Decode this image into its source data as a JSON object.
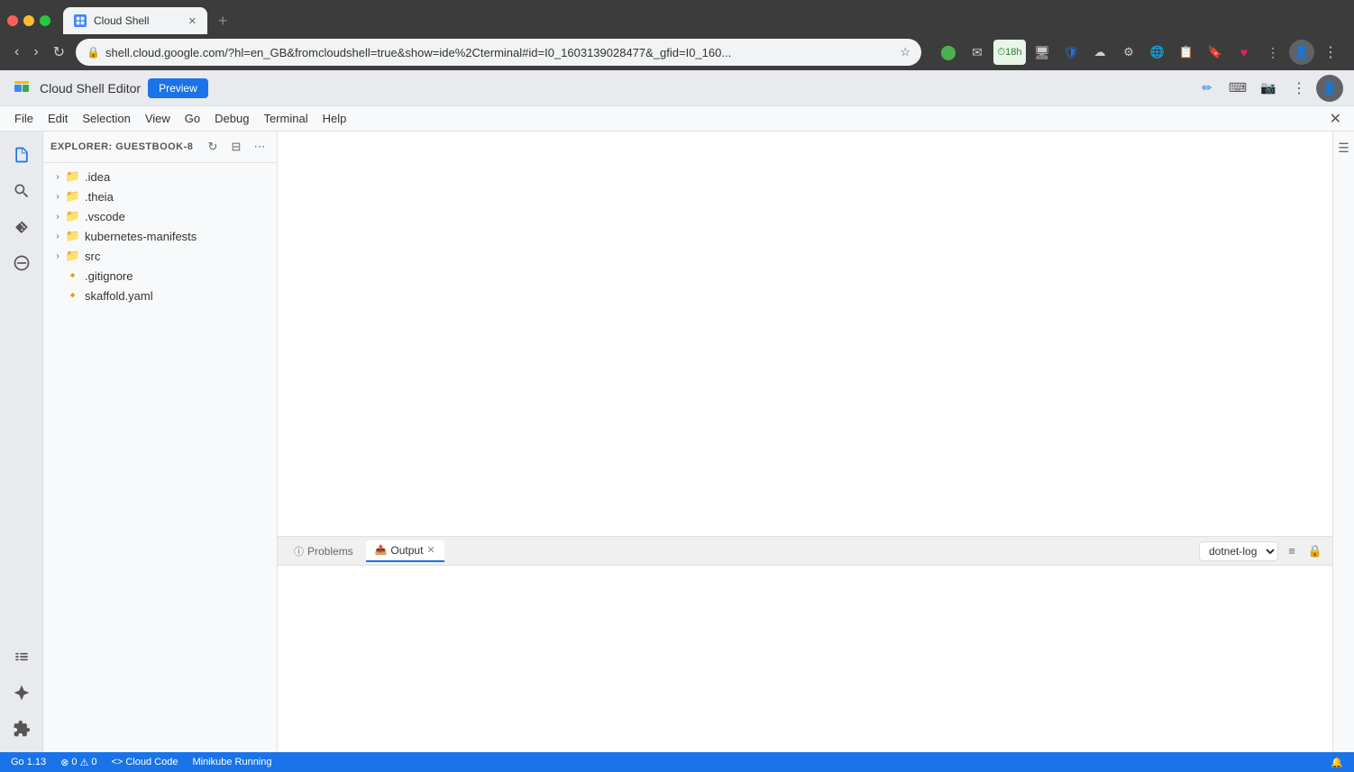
{
  "browser": {
    "tab_title": "Cloud Shell",
    "address": "shell.cloud.google.com/?hl=en_GB&fromcloudshell=true&show=ide%2Cterminal#id=I0_1603139028477&_gfid=I0_160...",
    "new_tab_label": "+"
  },
  "app": {
    "title": "Cloud Shell Editor",
    "preview_btn": "Preview"
  },
  "menu": {
    "items": [
      "File",
      "Edit",
      "Selection",
      "View",
      "Go",
      "Debug",
      "Terminal",
      "Help"
    ]
  },
  "explorer": {
    "header": "EXPLORER: GUESTBOOK-8",
    "folders": [
      {
        "name": ".idea",
        "type": "folder"
      },
      {
        "name": ".theia",
        "type": "folder"
      },
      {
        "name": ".vscode",
        "type": "folder"
      },
      {
        "name": "kubernetes-manifests",
        "type": "folder"
      },
      {
        "name": "src",
        "type": "folder"
      }
    ],
    "files": [
      {
        "name": ".gitignore",
        "type": "file",
        "color": "red"
      },
      {
        "name": "skaffold.yaml",
        "type": "file",
        "color": "red"
      }
    ]
  },
  "panel": {
    "tabs": [
      {
        "label": "Problems",
        "icon": "⓪",
        "active": false
      },
      {
        "label": "Output",
        "icon": "📤",
        "active": true,
        "closable": true
      }
    ],
    "dropdown_value": "dotnet-log"
  },
  "status_bar": {
    "go_version": "Go 1.13",
    "errors": "0",
    "warnings": "0",
    "cloud_code": "Cloud Code",
    "minikube": "Minikube Running",
    "bell_label": "🔔"
  }
}
